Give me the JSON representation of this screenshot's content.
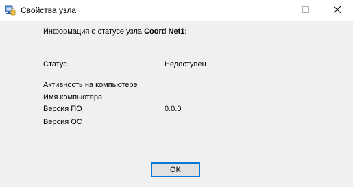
{
  "window": {
    "title": "Свойства узла",
    "icon": "network-node-icon",
    "controls": [
      "minimize-icon",
      "maximize-icon",
      "close-icon"
    ]
  },
  "heading": {
    "prefix": "Информация о статусе узла ",
    "node_name": "Coord Net1:"
  },
  "fields": {
    "status_label": "Статус",
    "status_value": "Недоступен",
    "activity_label": "Активность на компьютере",
    "computer_name_label": "Имя компьютера",
    "software_version_label": "Версия ПО",
    "software_version_value": "0.0.0",
    "os_version_label": "Версия ОС"
  },
  "buttons": {
    "ok_label": "OK"
  },
  "colors": {
    "focus_border": "#0078d7",
    "background": "#f0f0f0",
    "titlebar": "#ffffff"
  }
}
